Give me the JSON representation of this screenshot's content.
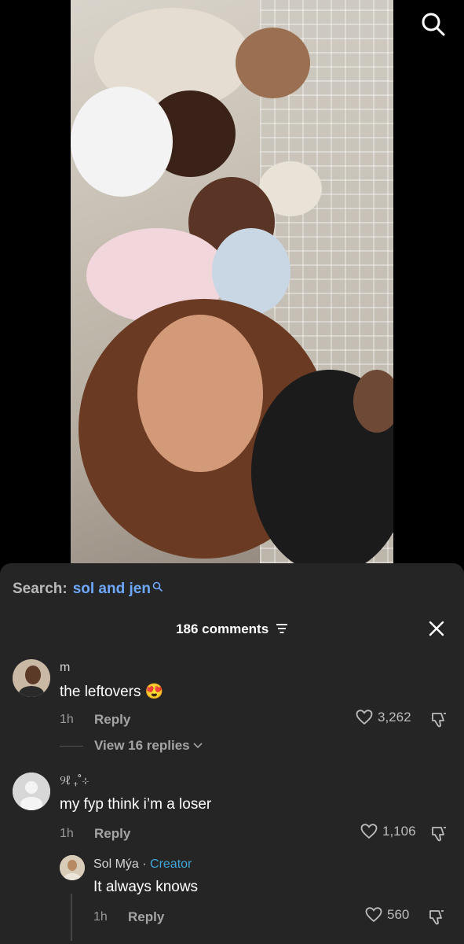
{
  "search": {
    "label": "Search:",
    "term": "sol and jen"
  },
  "comments_header": {
    "count_label": "186 comments"
  },
  "comments": [
    {
      "username": "m",
      "text": "the leftovers 😍",
      "time": "1h",
      "reply_label": "Reply",
      "likes": "3,262",
      "view_replies": "View 16 replies"
    },
    {
      "username": "୨ℓ ₊˚⊹",
      "text": "my fyp think i’m a loser",
      "time": "1h",
      "reply_label": "Reply",
      "likes": "1,106"
    }
  ],
  "reply": {
    "username": "Sol Mýa",
    "separator": " · ",
    "badge": "Creator",
    "text": "It always knows",
    "time": "1h",
    "reply_label": "Reply",
    "likes": "560"
  },
  "colors": {
    "sheet_bg": "#252525",
    "search_term": "#6ea8ff",
    "creator_badge": "#3fa6d9"
  }
}
